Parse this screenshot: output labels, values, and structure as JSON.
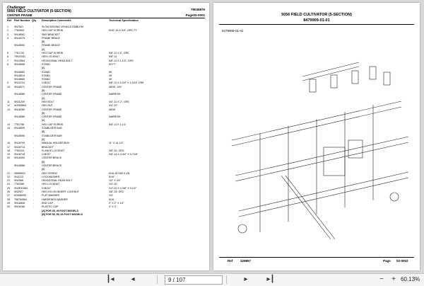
{
  "left_page": {
    "brand": "Challenger",
    "title": "5056 FIELD CULTIVATOR (5-SECTION)",
    "doc_number": "79035876",
    "section": "CENTER FRAME",
    "page_ref": "Page03-0001",
    "columns": {
      "ref": "Ref",
      "part": "Part Number",
      "qty": "Qty",
      "desc": "Description Comments",
      "spec": "Technical Specification"
    },
    "rows": [
      {
        "ref": "1",
        "pn": "SN7601",
        "qty": "-",
        "desc": "SLOW MOVING VEHICLE EMBLEM",
        "spec": ""
      },
      {
        "ref": "2",
        "pn": "7782809",
        "qty": "-",
        "desc": "HEX CAP SCREW",
        "spec": "5/16\"-18 X 3/4\", GR5, FT"
      },
      {
        "ref": "3",
        "pn": "SN18592",
        "qty": "-",
        "desc": "SMV BRACKET",
        "spec": ""
      },
      {
        "ref": "4",
        "pn": "SN18375",
        "qty": "-",
        "desc": "FRAME BRACE",
        "spec": ""
      },
      {
        "ref": "",
        "pn": "",
        "qty": "",
        "desc": "[B]",
        "spec": ""
      },
      {
        "ref": "",
        "pn": "SN18593",
        "qty": "-",
        "desc": "FRAME BRACE",
        "spec": ""
      },
      {
        "ref": "",
        "pn": "",
        "qty": "",
        "desc": "[A]",
        "spec": ""
      },
      {
        "ref": "5",
        "pn": "7761734",
        "qty": "-",
        "desc": "HEX CAP SCREW",
        "spec": "5/8\"-11 X 5\", GR5"
      },
      {
        "ref": "6",
        "pn": "79923351",
        "qty": "-",
        "desc": "HEX LOCKNUT",
        "spec": "5/8\"-11"
      },
      {
        "ref": "7",
        "pn": "SN13564",
        "qty": "-",
        "desc": "HEXAGONAL HEAD BOLT",
        "spec": "5/8\"-11 X 1-1/2\", GR5"
      },
      {
        "ref": "8",
        "pn": "SN18558",
        "qty": "-",
        "desc": "STAND",
        "spec": "59 FT"
      },
      {
        "ref": "",
        "pn": "",
        "qty": "",
        "desc": "[A]",
        "spec": ""
      },
      {
        "ref": "",
        "pn": "SN18583",
        "qty": "-",
        "desc": "STAND",
        "spec": "55'"
      },
      {
        "ref": "",
        "pn": "SN18613",
        "qty": "-",
        "desc": "STAND",
        "spec": "45'"
      },
      {
        "ref": "",
        "pn": "SN18680",
        "qty": "-",
        "desc": "STAND",
        "spec": "49'"
      },
      {
        "ref": "9",
        "pn": "SN10703",
        "qty": "-",
        "desc": "U-BOLT",
        "spec": "5/8\"-11 X 4-3/4\" X 4-3/16\",GR5"
      },
      {
        "ref": "10",
        "pn": "SN18371",
        "qty": "-",
        "desc": "CENTER FRAME",
        "spec": "WIDE, 100\""
      },
      {
        "ref": "",
        "pn": "",
        "qty": "",
        "desc": "[B]",
        "spec": ""
      },
      {
        "ref": "",
        "pn": "SN18586",
        "qty": "-",
        "desc": "CENTER FRAME",
        "spec": "NARROW"
      },
      {
        "ref": "",
        "pn": "",
        "qty": "",
        "desc": "[A]",
        "spec": ""
      },
      {
        "ref": "11",
        "pn": "SN11209",
        "qty": "-",
        "desc": "HEX BOLT",
        "spec": "3/4\"-10 X 2\", GR5"
      },
      {
        "ref": "12",
        "pn": "AG083864",
        "qty": "-",
        "desc": "HEX NUT",
        "spec": "3/4\"-10"
      },
      {
        "ref": "13",
        "pn": "SN18359",
        "qty": "-",
        "desc": "CENTER FRAME",
        "spec": "WIDE"
      },
      {
        "ref": "",
        "pn": "",
        "qty": "",
        "desc": "[B]",
        "spec": ""
      },
      {
        "ref": "",
        "pn": "SN18586",
        "qty": "-",
        "desc": "CENTER FRAME",
        "spec": "NARROW"
      },
      {
        "ref": "",
        "pn": "",
        "qty": "",
        "desc": "[A]",
        "spec": ""
      },
      {
        "ref": "14",
        "pn": "7761758",
        "qty": "-",
        "desc": "HEX CAP SCREW",
        "spec": "5/8\"-11 X 1-1/2"
      },
      {
        "ref": "15",
        "pn": "SN18599",
        "qty": "-",
        "desc": "STABILIZER BAR",
        "spec": ""
      },
      {
        "ref": "",
        "pn": "",
        "qty": "",
        "desc": "[B]",
        "spec": ""
      },
      {
        "ref": "",
        "pn": "SN18595",
        "qty": "-",
        "desc": "STABILIZER BAR",
        "spec": ""
      },
      {
        "ref": "",
        "pn": "",
        "qty": "",
        "desc": "[A]",
        "spec": ""
      },
      {
        "ref": "16",
        "pn": "SN18709",
        "qty": "-",
        "desc": "MANUAL HOLDER BOX",
        "spec": "11\" X 14-1/2\""
      },
      {
        "ref": "17",
        "pn": "SN18713",
        "qty": "-",
        "desc": "BRACKET",
        "spec": ""
      },
      {
        "ref": "18",
        "pn": "7764104",
        "qty": "-",
        "desc": "FLANGE LOCKNUT",
        "spec": "3/8\"-16, GRG"
      },
      {
        "ref": "19",
        "pn": "SN18718",
        "qty": "-",
        "desc": "U-BOLT",
        "spec": "3/8\"-16 X 3-3/4\" X 3-7/16\""
      },
      {
        "ref": "20",
        "pn": "SN18394",
        "qty": "-",
        "desc": "CENTER BRACE",
        "spec": ""
      },
      {
        "ref": "",
        "pn": "",
        "qty": "",
        "desc": "[B]",
        "spec": ""
      },
      {
        "ref": "",
        "pn": "SN18586",
        "qty": "-",
        "desc": "CENTER BRACE",
        "spec": ""
      },
      {
        "ref": "",
        "pn": "",
        "qty": "",
        "desc": "[A]",
        "spec": ""
      },
      {
        "ref": "21",
        "pn": "35558531",
        "qty": "-",
        "desc": "HEX SCREW",
        "spec": "5/16-18 SAE 5 ZN"
      },
      {
        "ref": "22",
        "pn": "SN3723",
        "qty": "-",
        "desc": "LOCKWASHER",
        "spec": "5/16\""
      },
      {
        "ref": "23",
        "pn": "SN2568",
        "qty": "-",
        "desc": "HEXAGONAL HEAD BOLT",
        "spec": "1/4\" X 3/4\""
      },
      {
        "ref": "24",
        "pn": "7764385",
        "qty": "-",
        "desc": "HEX LOCKNUT",
        "spec": "1/4\"-20"
      },
      {
        "ref": "25",
        "pn": "SN3R11582",
        "qty": "-",
        "desc": "U-BOLT",
        "spec": "1/4\"-20 X 2-3/8\" X 3-1/2\""
      },
      {
        "ref": "26",
        "pn": "SN3927",
        "qty": "-",
        "desc": "HEX NYLON INSERT LOCKNUT",
        "spec": "3/8\"-16, GR2"
      },
      {
        "ref": "27",
        "pn": "AG058292",
        "qty": "-",
        "desc": "FLAT WASHER",
        "spec": "1/4\""
      },
      {
        "ref": "28",
        "pn": "798769563",
        "qty": "-",
        "desc": "HARDENED WASHER",
        "spec": "5/16"
      },
      {
        "ref": "29",
        "pn": "SN18608",
        "qty": "-",
        "desc": "END CAP",
        "spec": "2\" X 2\" X 1/4\""
      },
      {
        "ref": "30",
        "pn": "SN18166",
        "qty": "-",
        "desc": "PLASTIC CAP",
        "spec": "4\" X 3\""
      }
    ],
    "notes": [
      "[A] FOR 45, 49 FOOT MODELS",
      "[B] FOR 55, 59, 63 FOOT MODELS"
    ]
  },
  "right_page": {
    "title": "5056 FIELD CULTIVATOR (5-SECTION)",
    "drawing_number": "8479909-01-01",
    "drawing_id": "8479909-01-01",
    "footer_ref_label": "Ref",
    "footer_ref": "329857",
    "footer_page_label": "Page",
    "footer_page": "02-0002"
  },
  "toolbar": {
    "page_field": "9 / 107",
    "zoom": "60.13%"
  },
  "icons": {
    "first": "first-page-icon",
    "prev": "previous-page-icon",
    "next": "next-page-icon",
    "last": "last-page-icon",
    "zoom_out": "zoom-out-icon",
    "zoom_in": "zoom-in-icon"
  }
}
